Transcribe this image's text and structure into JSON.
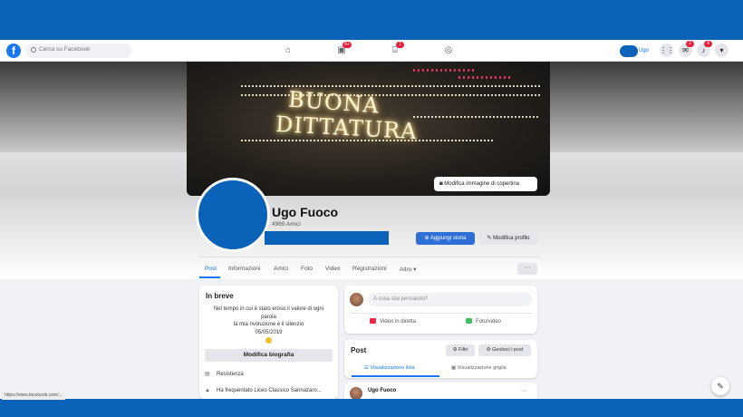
{
  "navbar": {
    "search_placeholder": "Cerca su Facebook",
    "logo_letter": "f",
    "icons": [
      {
        "name": "home-icon",
        "glyph": "⌂",
        "badge": ""
      },
      {
        "name": "watch-icon",
        "glyph": "▣",
        "badge": "9+"
      },
      {
        "name": "marketplace-icon",
        "glyph": "⌸",
        "badge": "1"
      },
      {
        "name": "groups-icon",
        "glyph": "◎",
        "badge": ""
      }
    ],
    "user_name": "Ugo",
    "menu_badge": "",
    "messenger_badge": "2",
    "notifications_badge": "4"
  },
  "cover": {
    "line1": "BUONA",
    "line2": "DITTATURA",
    "edit_button": "Modifica immagine di copertina"
  },
  "profile": {
    "name": "Ugo Fuoco",
    "friends": "4969 Amici",
    "story_button": "Aggiungi storia",
    "edit_button": "Modifica profilo"
  },
  "tabs": [
    "Post",
    "Informazioni",
    "Amici",
    "Foto",
    "Video",
    "Registrazioni",
    "Altro ▾"
  ],
  "tabs_more": "···",
  "intro": {
    "title": "In breve",
    "bio_lines": [
      "Nel tempo in cui è stato eroso il valore di ogni",
      "parola",
      "la mia rivoluzione è il silenzio",
      "05/05/2019"
    ],
    "edit_bio_button": "Modifica biografia",
    "rows": [
      {
        "icon": "briefcase-icon",
        "glyph": "▤",
        "text": "Resistenza"
      },
      {
        "icon": "school-icon",
        "glyph": "▲",
        "text": "Ha frequentato Liceo Classico Sannazaro..."
      }
    ]
  },
  "composer": {
    "placeholder": "A cosa stai pensando?",
    "actions": [
      {
        "name": "live-video-action",
        "label": "Video in diretta",
        "color": "#f02849"
      },
      {
        "name": "photo-video-action",
        "label": "Foto/video",
        "color": "#45bd62"
      }
    ]
  },
  "posts": {
    "title": "Post",
    "filters_button": "Filtri",
    "manage_button": "Gestisci i post",
    "view_list": "Visualizzazione lista",
    "view_grid": "Visualizzazione griglia"
  },
  "first_post": {
    "author": "Ugo Fuoco",
    "menu": "···"
  },
  "status_url": "https://www.facebook.com/...",
  "fab_glyph": "✎",
  "colors": {
    "brand_blue": "#1877f2",
    "redaction_blue": "#0a63b8",
    "badge_red": "#e41e3f"
  }
}
